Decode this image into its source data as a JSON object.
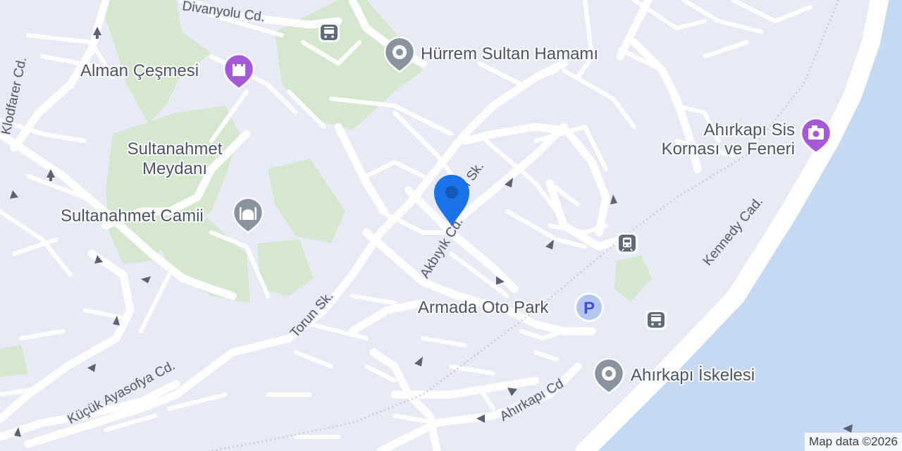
{
  "map": {
    "colors": {
      "land": "#e8ebf5",
      "road": "#ffffff",
      "park": "#d5e8cf",
      "water": "#c5daf2",
      "label": "#4a5363",
      "poi_gray": "#8a949e",
      "poi_purple": "#a459d6",
      "marker": "#1a73e8"
    },
    "street_labels": {
      "divanyolu": "Divanyolu Cd.",
      "klodfarer": "Klodfarer Cd.",
      "akbiyik": "Akbıyık Cd.",
      "gun": "gün Sk.",
      "torun": "Torun Sk.",
      "kucuk_ayasofya": "Küçük Ayasofya Cd.",
      "ahirkapi_cd": "Ahırkapı Cd",
      "kennedy": "Kennedy Cad."
    },
    "place_labels": {
      "hurrem": "Hürrem Sultan Hamamı",
      "alman": "Alman Çeşmesi",
      "meydan_line1": "Sultanahmet",
      "meydan_line2": "Meydanı",
      "camii": "Sultanahmet Camii",
      "sis_line1": "Ahırkapı Sis",
      "sis_line2": "Kornası ve Feneri",
      "armada": "Armada Oto Park",
      "iskelesi": "Ahırkapı İskelesi"
    },
    "icons": {
      "hurrem": "landmark-pin-icon",
      "alman": "castle-pin-icon",
      "camii": "mosque-pin-icon",
      "sis": "camera-pin-icon",
      "armada": "parking-icon",
      "iskelesi": "landmark-pin-icon",
      "bus": "bus-stop-icon",
      "tram": "tram-stop-icon",
      "marker": "location-marker-icon"
    },
    "parking_glyph": "P",
    "attribution": "Map data ©2026"
  }
}
